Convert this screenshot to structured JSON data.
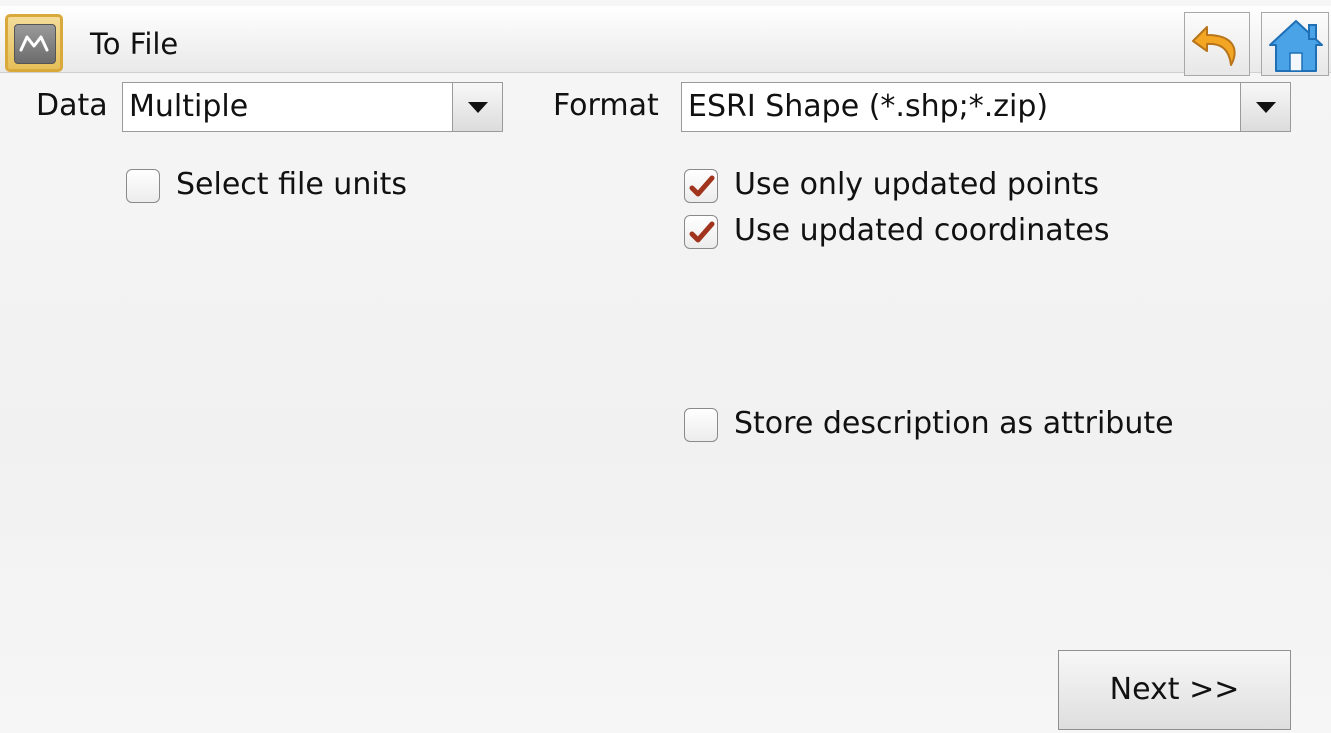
{
  "header": {
    "title": "To File",
    "menu_icon": "m-logo-icon",
    "back_icon": "undo-arrow-icon",
    "home_icon": "home-icon"
  },
  "form": {
    "data": {
      "label": "Data",
      "selected": "Multiple"
    },
    "format": {
      "label": "Format",
      "selected": "ESRI Shape (*.shp;*.zip)"
    },
    "checkboxes": [
      {
        "label": "Select file units",
        "checked": false
      },
      {
        "label": "Use only updated points",
        "checked": true
      },
      {
        "label": "Use updated coordinates",
        "checked": true
      },
      {
        "label": "Store description as attribute",
        "checked": false
      }
    ]
  },
  "footer": {
    "next_label": "Next >>"
  },
  "colors": {
    "check_mark": "#a0341c",
    "menu_border": "#d9a93c",
    "back_arrow": "#f0a020",
    "home_blue": "#3a8fd8"
  }
}
